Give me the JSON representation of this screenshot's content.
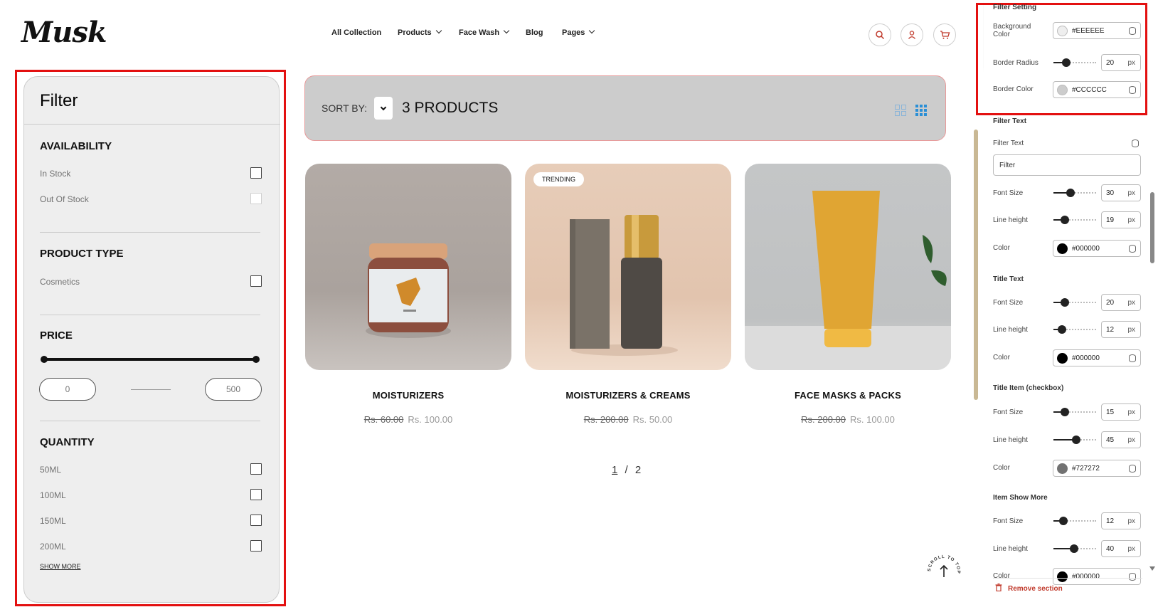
{
  "header": {
    "logo": "Musk",
    "nav": [
      {
        "label": "All Collection",
        "dropdown": false
      },
      {
        "label": "Products",
        "dropdown": true
      },
      {
        "label": "Face Wash",
        "dropdown": true
      },
      {
        "label": "Blog",
        "dropdown": false
      },
      {
        "label": "Pages",
        "dropdown": true
      }
    ],
    "icons": [
      "search-icon",
      "user-icon",
      "cart-icon"
    ]
  },
  "filter": {
    "title": "Filter",
    "availability": {
      "heading": "AVAILABILITY",
      "items": [
        "In Stock",
        "Out Of Stock"
      ]
    },
    "product_type": {
      "heading": "PRODUCT TYPE",
      "items": [
        "Cosmetics"
      ]
    },
    "price": {
      "heading": "PRICE",
      "min": "0",
      "max": "500"
    },
    "quantity": {
      "heading": "QUANTITY",
      "items": [
        "50ML",
        "100ML",
        "150ML",
        "200ML"
      ]
    },
    "show_more": "SHOW MORE"
  },
  "sortbar": {
    "label": "SORT BY:",
    "count": "3 PRODUCTS"
  },
  "products": [
    {
      "name": "MOISTURIZERS",
      "old_price": "Rs. 60.00",
      "price": "Rs. 100.00",
      "badge": ""
    },
    {
      "name": "MOISTURIZERS & CREAMS",
      "old_price": "Rs. 200.00",
      "price": "Rs. 50.00",
      "badge": "TRENDING"
    },
    {
      "name": "FACE MASKS & PACKS",
      "old_price": "Rs. 200.00",
      "price": "Rs. 100.00",
      "badge": ""
    }
  ],
  "pager": {
    "current": "1",
    "sep": "/",
    "total": "2"
  },
  "scroll_top": "SCROLL TO TOP",
  "panel": {
    "filter_setting": {
      "title": "Filter Setting",
      "bg_label": "Background Color",
      "bg_value": "#EEEEEE",
      "radius_label": "Border Radius",
      "radius_value": "20",
      "radius_unit": "px",
      "border_label": "Border Color",
      "border_value": "#CCCCCC"
    },
    "filter_text": {
      "title": "Filter Text",
      "text_label": "Filter Text",
      "text_value": "Filter",
      "font_label": "Font Size",
      "font_value": "30",
      "lh_label": "Line height",
      "lh_value": "19",
      "color_label": "Color",
      "color_value": "#000000"
    },
    "title_text": {
      "title": "Title Text",
      "font_label": "Font Size",
      "font_value": "20",
      "lh_label": "Line height",
      "lh_value": "12",
      "color_label": "Color",
      "color_value": "#000000"
    },
    "title_item": {
      "title": "Title Item (checkbox)",
      "font_label": "Font Size",
      "font_value": "15",
      "lh_label": "Line height",
      "lh_value": "45",
      "color_label": "Color",
      "color_value": "#727272"
    },
    "item_show_more": {
      "title": "Item Show More",
      "font_label": "Font Size",
      "font_value": "12",
      "lh_label": "Line height",
      "lh_value": "40",
      "color_label": "Color",
      "color_value": "#000000"
    },
    "unit": "px",
    "remove": "Remove section"
  },
  "colors": {
    "highlight": "#e31010",
    "accent": "#2a8fd6",
    "remove": "#c0392b"
  }
}
